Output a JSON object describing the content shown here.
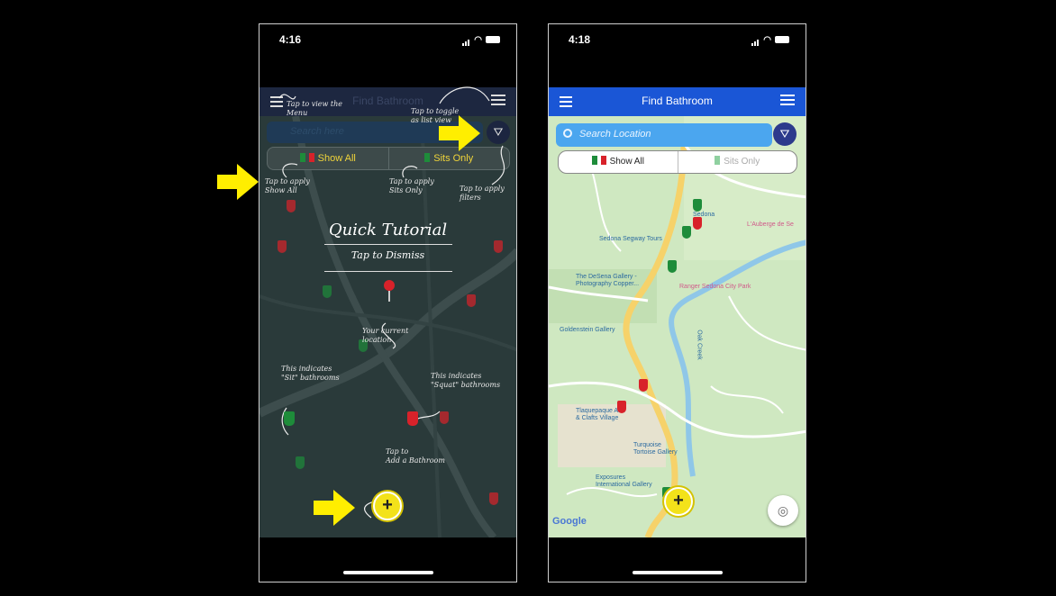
{
  "left_phone": {
    "status_time": "4:16",
    "nav_title": "Find Bathroom",
    "search_placeholder": "Search here",
    "toggle": {
      "show_all": "Show All",
      "sits_only": "Sits Only"
    },
    "tutorial": {
      "title": "Quick Tutorial",
      "subtitle": "Tap to Dismiss",
      "notes": {
        "menu": "Tap to view the\nMenu",
        "list": "Tap to toggle\nas list view",
        "show_all": "Tap to apply\nShow All",
        "sits_only": "Tap to apply\nSits Only",
        "filters": "Tap to apply\nfilters",
        "location": "Your current\nlocation",
        "sit": "This indicates\n\"Sit\" bathrooms",
        "squat": "This indicates\n\"Squat\" bathrooms",
        "add": "Tap to\nAdd a Bathroom"
      }
    }
  },
  "right_phone": {
    "status_time": "4:18",
    "nav_title": "Find Bathroom",
    "search_placeholder": "Search Location",
    "toggle": {
      "show_all": "Show All",
      "sits_only": "Sits Only"
    },
    "map_labels": {
      "segway": "Sedona Segway Tours",
      "desena": "The DeSena Gallery -\nPhotography Copper...",
      "goldenstein": "Goldenstein Gallery",
      "tlaquepaque": "Tlaquepaque Arts\n& Clafts Village",
      "turquoise": "Turquoise\nTortoise Gallery",
      "exposures": "Exposures\nInternational Gallery",
      "lauberge": "L'Auberge de Se",
      "park": "Ranger Sedona City Park",
      "town": "Sedona",
      "creek": "Oak Creek"
    },
    "google": "Google"
  },
  "colors": {
    "nav_blue": "#1a56d6",
    "search_blue": "#4ba6ef",
    "pin_green": "#1e8c3a",
    "pin_red": "#d8222a",
    "fab_yellow": "#f3e21a",
    "arrow_yellow": "#ffee00"
  }
}
